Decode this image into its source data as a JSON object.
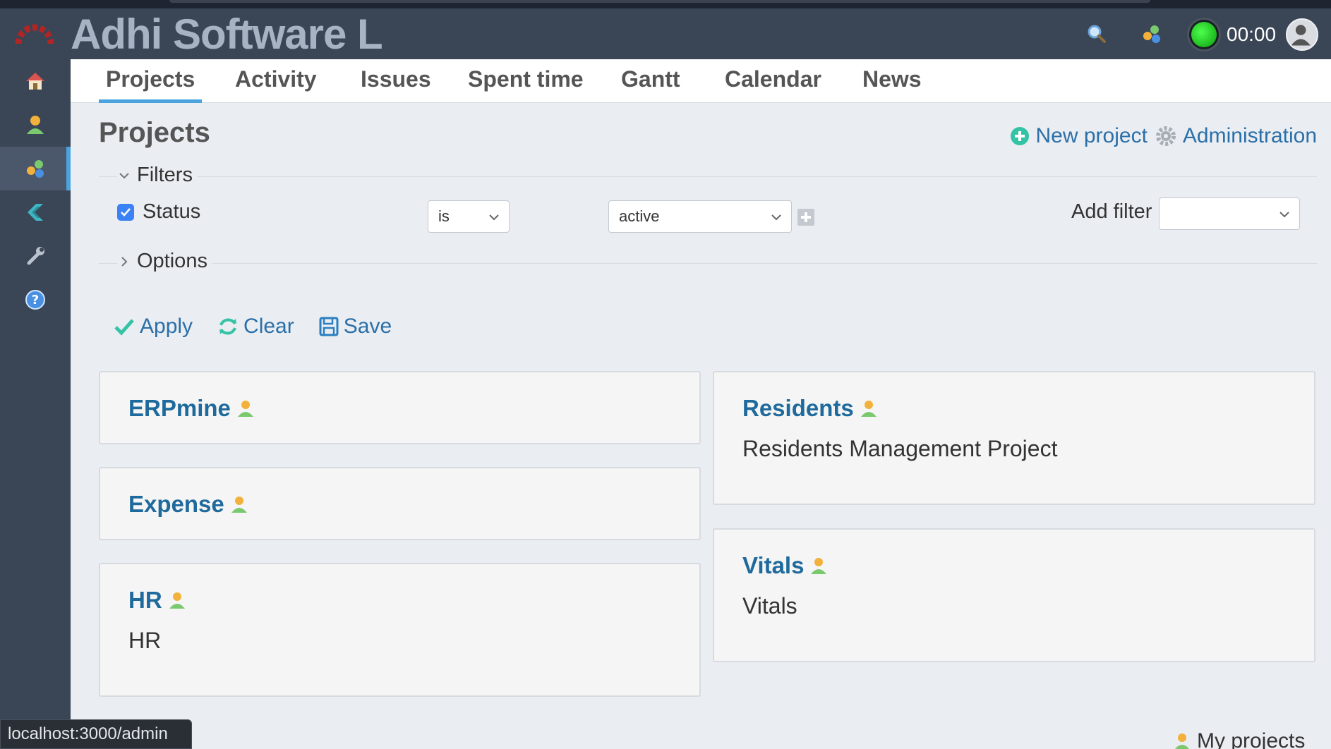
{
  "app": {
    "title": "Adhi Software L"
  },
  "header": {
    "timer_text": "00:00"
  },
  "sidebar": {
    "items": [
      {
        "name": "home",
        "icon": "home-icon"
      },
      {
        "name": "my-page",
        "icon": "user-icon"
      },
      {
        "name": "projects",
        "icon": "projects-icon",
        "active": true
      },
      {
        "name": "erp",
        "icon": "erp-icon"
      },
      {
        "name": "administration",
        "icon": "wrench-icon"
      },
      {
        "name": "help",
        "icon": "help-icon"
      }
    ]
  },
  "tabs": [
    {
      "label": "Projects",
      "active": true
    },
    {
      "label": "Activity"
    },
    {
      "label": "Issues"
    },
    {
      "label": "Spent time"
    },
    {
      "label": "Gantt"
    },
    {
      "label": "Calendar"
    },
    {
      "label": "News"
    }
  ],
  "page": {
    "title": "Projects",
    "new_project_label": "New project",
    "administration_label": "Administration"
  },
  "filters": {
    "legend": "Filters",
    "status_label": "Status",
    "status_checked": true,
    "operator_value": "is",
    "status_value": "active",
    "add_filter_label": "Add filter",
    "add_filter_value": ""
  },
  "options": {
    "legend": "Options"
  },
  "actions": {
    "apply": "Apply",
    "clear": "Clear",
    "save": "Save"
  },
  "projects": {
    "left": [
      {
        "name": "ERPmine",
        "description": ""
      },
      {
        "name": "Expense",
        "description": ""
      },
      {
        "name": "HR",
        "description": "HR"
      }
    ],
    "right": [
      {
        "name": "Residents",
        "description": "Residents Management Project"
      },
      {
        "name": "Vitals",
        "description": "Vitals"
      }
    ]
  },
  "footer": {
    "status_url": "localhost:3000/admin",
    "my_projects_label": "My projects"
  },
  "colors": {
    "topbar": "#3a4556",
    "link": "#1f6a9c",
    "accent": "#4aa3df",
    "apply_check": "#35c3a6"
  }
}
